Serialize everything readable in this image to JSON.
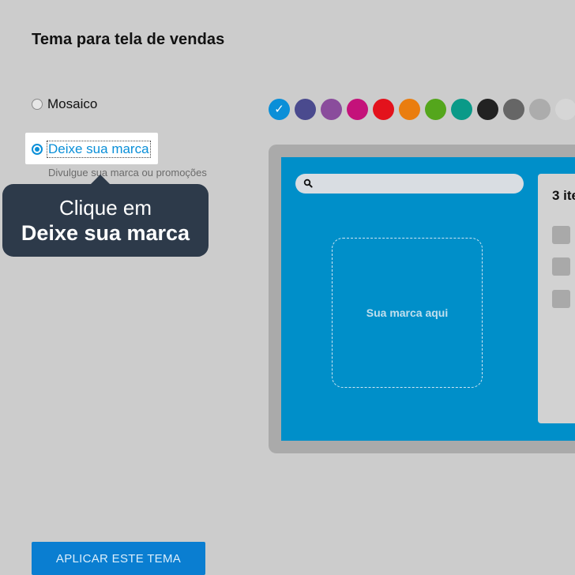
{
  "page": {
    "title": "Tema para tela de vendas"
  },
  "options": [
    {
      "label": "Mosaico",
      "selected": false
    },
    {
      "label": "Deixe sua marca",
      "selected": true,
      "description": "Divulgue sua marca ou promoções"
    }
  ],
  "tooltip": {
    "line1": "Clique em",
    "line2": "Deixe sua marca"
  },
  "colors": [
    {
      "hex": "#0a8fd8",
      "selected": true
    },
    {
      "hex": "#4a4a8e",
      "selected": false
    },
    {
      "hex": "#8a4c9c",
      "selected": false
    },
    {
      "hex": "#c4127a",
      "selected": false
    },
    {
      "hex": "#e3121c",
      "selected": false
    },
    {
      "hex": "#ea7d0f",
      "selected": false
    },
    {
      "hex": "#54a61c",
      "selected": false
    },
    {
      "hex": "#0a9a88",
      "selected": false
    },
    {
      "hex": "#222222",
      "selected": false
    },
    {
      "hex": "#666666",
      "selected": false
    },
    {
      "hex": "#acacac",
      "selected": false
    },
    {
      "hex": "#d6d6d6",
      "selected": false
    }
  ],
  "preview": {
    "brand_placeholder": "Sua marca aqui",
    "cart_title": "3 ite"
  },
  "actions": {
    "apply_label": "APLICAR ESTE TEMA"
  }
}
